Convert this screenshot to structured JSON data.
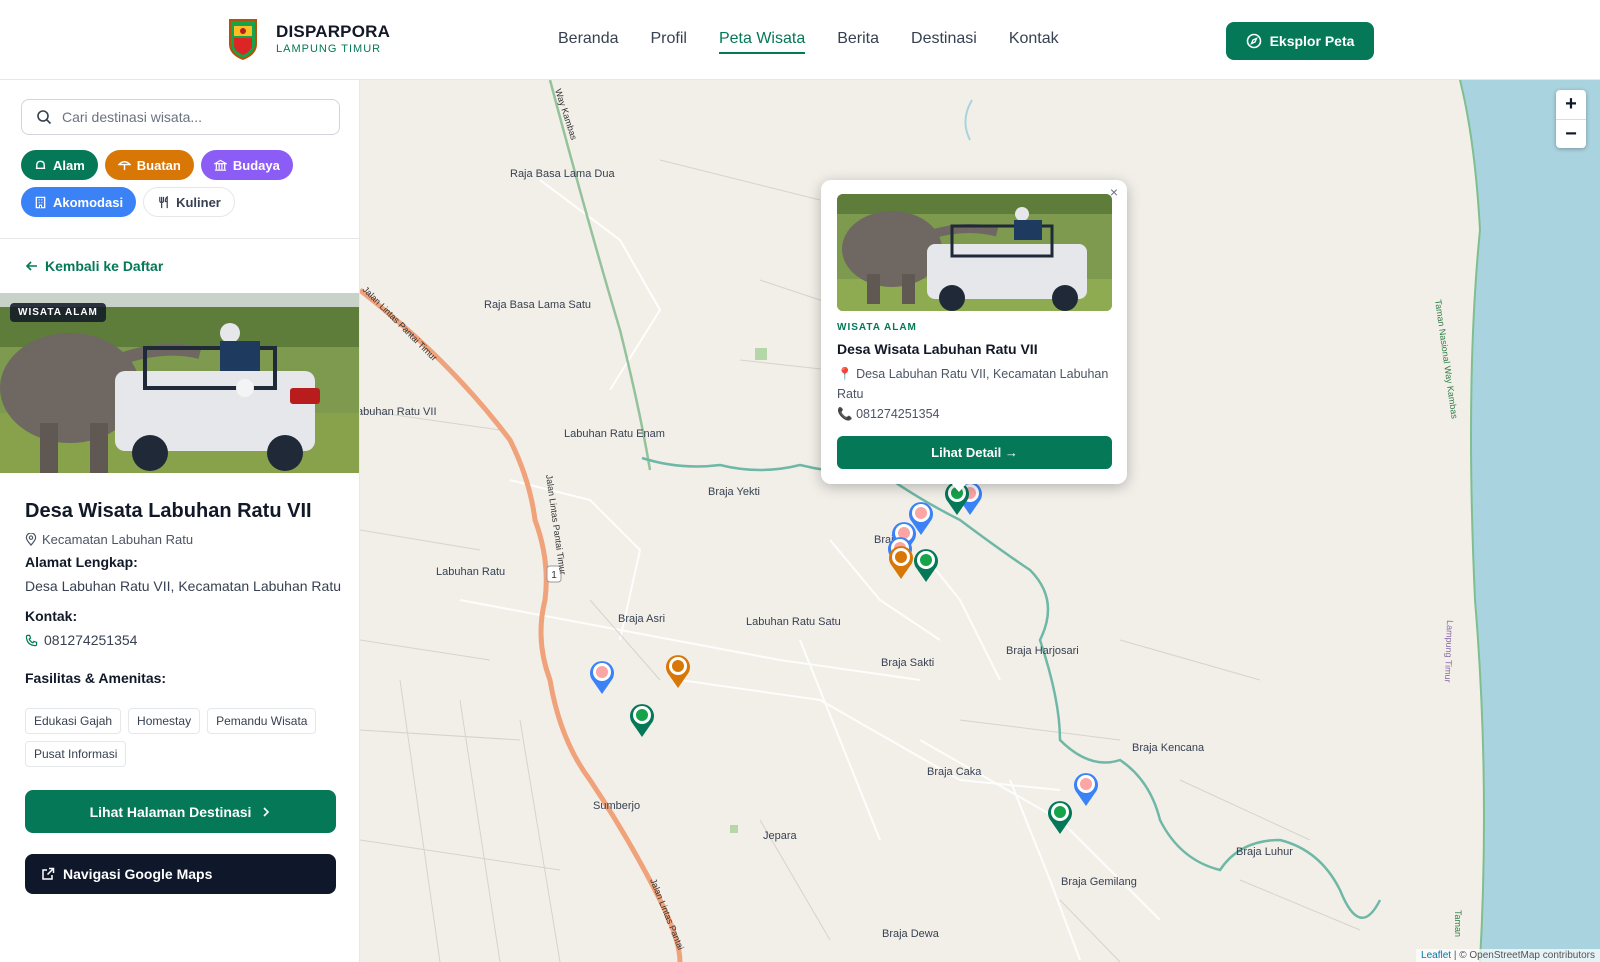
{
  "header": {
    "brand_title": "DISPARPORA",
    "brand_subtitle": "LAMPUNG TIMUR",
    "nav": [
      "Beranda",
      "Profil",
      "Peta Wisata",
      "Berita",
      "Destinasi",
      "Kontak"
    ],
    "active_nav": "Peta Wisata",
    "cta_label": "Eksplor Peta"
  },
  "sidebar": {
    "search_placeholder": "Cari destinasi wisata...",
    "filters": [
      {
        "label": "Alam",
        "color": "#047857",
        "icon": "bell-icon"
      },
      {
        "label": "Buatan",
        "color": "#d97706",
        "icon": "umbrella-icon"
      },
      {
        "label": "Budaya",
        "color": "#8b5cf6",
        "icon": "museum-icon"
      },
      {
        "label": "Akomodasi",
        "color": "#3b82f6",
        "icon": "building-icon"
      },
      {
        "label": "Kuliner",
        "color": "#ffffff",
        "icon": "utensils-icon"
      }
    ],
    "back_label": "Kembali ke Daftar",
    "detail": {
      "badge": "WISATA ALAM",
      "title": "Desa Wisata Labuhan Ratu VII",
      "kecamatan": "Kecamatan Labuhan Ratu",
      "address_label": "Alamat Lengkap:",
      "address": "Desa Labuhan Ratu VII, Kecamatan Labuhan Ratu",
      "contact_label": "Kontak:",
      "phone": "081274251354",
      "facilities_label": "Fasilitas & Amenitas:",
      "facilities": [
        "Edukasi Gajah",
        "Homestay",
        "Pemandu Wisata",
        "Pusat Informasi"
      ],
      "dest_button": "Lihat Halaman Destinasi",
      "maps_button": "Navigasi Google Maps"
    }
  },
  "map": {
    "zoom_in": "+",
    "zoom_out": "−",
    "places": [
      "Raja Basa Lama Dua",
      "Raja Basa Lama Satu",
      "Labuhan Ratu Enam",
      "Braja Yekti",
      "Labuhan Ratu",
      "Braja Asri",
      "Labuhan Ratu Satu",
      "Braja Sakti",
      "Braja Harjosari",
      "Braja Kencana",
      "Braja Caka",
      "Sumberjo",
      "Jepara",
      "Braja Luhur",
      "Braja Gemilang",
      "Braja Dewa",
      "Braja",
      "abuhan Ratu VII"
    ],
    "road_labels": [
      "Way Kambas",
      "Jalan Lintas Pantai Timur",
      "Jalan Lintas Pantai Timur",
      "Jalan Lintas Pantai",
      "Taman Nasional Way Kambas",
      "Lampung Timur",
      "Taman"
    ],
    "route_badge": "1",
    "popup": {
      "category": "WISATA ALAM",
      "title": "Desa Wisata Labuhan Ratu VII",
      "address": "Desa Labuhan Ratu VII, Kecamatan Labuhan Ratu",
      "phone": "081274251354",
      "button": "Lihat Detail →",
      "close": "×"
    },
    "attribution_leaflet": "Leaflet",
    "attribution_rest": " | © OpenStreetMap contributors",
    "colors": {
      "alam": "#047857",
      "buatan": "#d97706",
      "akomodasi": "#3b82f6",
      "water": "#a9d3df",
      "river": "#6fb7a6",
      "road": "#f0a27a"
    }
  }
}
